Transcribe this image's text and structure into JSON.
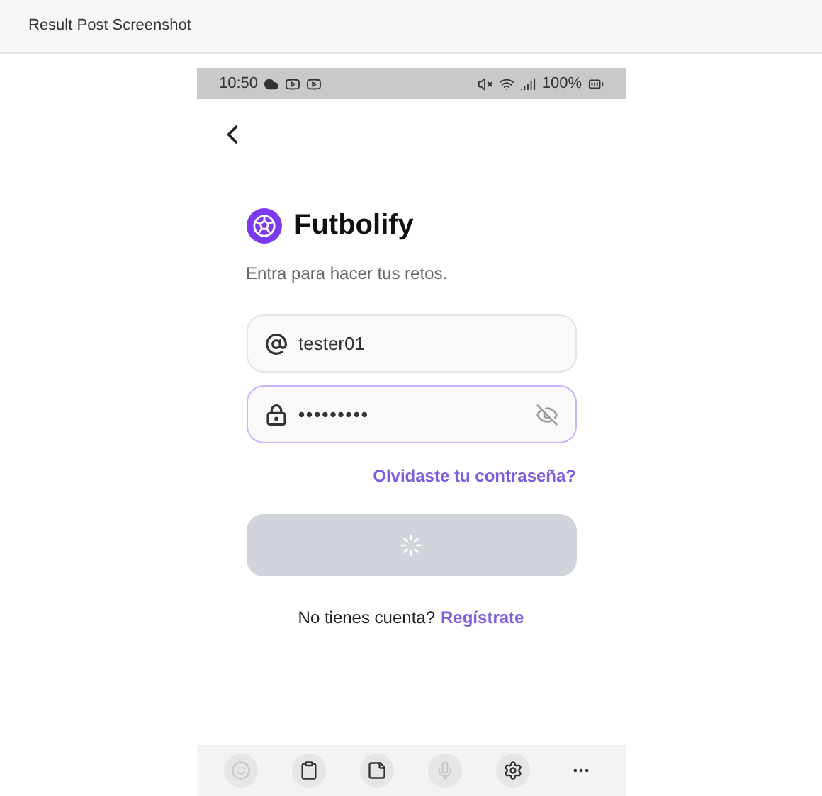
{
  "window": {
    "title": "Result Post Screenshot"
  },
  "status_bar": {
    "time": "10:50",
    "battery": "100%"
  },
  "brand": {
    "name": "Futbolify",
    "subtitle": "Entra para hacer tus retos."
  },
  "username": {
    "value": "tester01",
    "focused": false
  },
  "password": {
    "value": "•••••••••",
    "focused": true
  },
  "forgot_link": "Olvidaste tu contraseña?",
  "login_button": {
    "loading": true,
    "disabled": true
  },
  "signup": {
    "text": "No tienes cuenta?",
    "link": "Regístrate"
  },
  "keyboard_toolbar": [
    {
      "kind": "emoji",
      "disabled": true
    },
    {
      "kind": "clipboard",
      "disabled": false
    },
    {
      "kind": "sticker",
      "disabled": false
    },
    {
      "kind": "mic",
      "disabled": true
    },
    {
      "kind": "settings",
      "disabled": false
    },
    {
      "kind": "more",
      "disabled": false
    }
  ]
}
